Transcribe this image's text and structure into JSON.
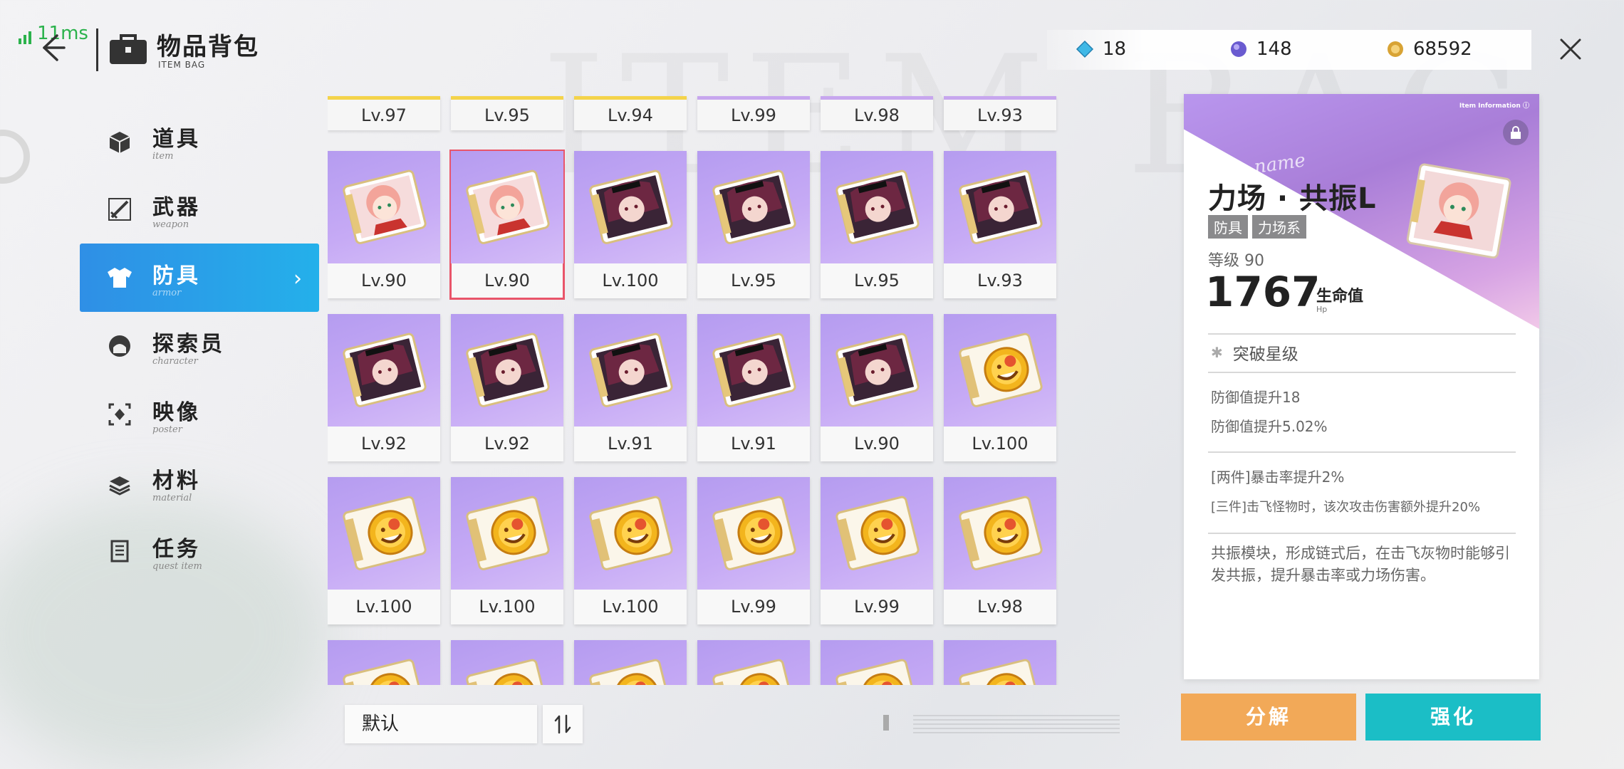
{
  "status": {
    "ping": "11ms"
  },
  "header": {
    "title": "物品背包",
    "subtitle": "ITEM BAG",
    "watermark": "ITEM BAG"
  },
  "currencies": [
    {
      "name": "crystal",
      "value": "18",
      "color": "#3fb8e6"
    },
    {
      "name": "orb",
      "value": "148",
      "color": "#6a5bd0"
    },
    {
      "name": "coin",
      "value": "68592",
      "color": "#d8a334"
    }
  ],
  "menu": [
    {
      "key": "item",
      "label": "道具",
      "sub": "item",
      "icon": "box-icon",
      "active": false
    },
    {
      "key": "weapon",
      "label": "武器",
      "sub": "weapon",
      "icon": "sword-icon",
      "active": false
    },
    {
      "key": "armor",
      "label": "防具",
      "sub": "armor",
      "icon": "shirt-icon",
      "active": true
    },
    {
      "key": "character",
      "label": "探索员",
      "sub": "character",
      "icon": "character-icon",
      "active": false
    },
    {
      "key": "poster",
      "label": "映像",
      "sub": "poster",
      "icon": "poster-icon",
      "active": false
    },
    {
      "key": "material",
      "label": "材料",
      "sub": "material",
      "icon": "material-icon",
      "active": false
    },
    {
      "key": "quest",
      "label": "任务",
      "sub": "quest item",
      "icon": "list-icon",
      "active": false
    }
  ],
  "top_row": [
    {
      "level": "Lv.97",
      "rarity": "gold"
    },
    {
      "level": "Lv.95",
      "rarity": "gold"
    },
    {
      "level": "Lv.94",
      "rarity": "gold"
    },
    {
      "level": "Lv.99",
      "rarity": "purple"
    },
    {
      "level": "Lv.98",
      "rarity": "purple"
    },
    {
      "level": "Lv.93",
      "rarity": "purple"
    }
  ],
  "cards": [
    {
      "level": "Lv.90",
      "art": "pink",
      "selected": false
    },
    {
      "level": "Lv.90",
      "art": "pink",
      "selected": true
    },
    {
      "level": "Lv.100",
      "art": "dark",
      "selected": false
    },
    {
      "level": "Lv.95",
      "art": "dark",
      "selected": false
    },
    {
      "level": "Lv.95",
      "art": "dark",
      "selected": false
    },
    {
      "level": "Lv.93",
      "art": "dark",
      "selected": false
    },
    {
      "level": "Lv.92",
      "art": "dark",
      "selected": false
    },
    {
      "level": "Lv.92",
      "art": "dark",
      "selected": false
    },
    {
      "level": "Lv.91",
      "art": "dark",
      "selected": false
    },
    {
      "level": "Lv.91",
      "art": "dark",
      "selected": false
    },
    {
      "level": "Lv.90",
      "art": "dark",
      "selected": false
    },
    {
      "level": "Lv.100",
      "art": "sun",
      "selected": false
    },
    {
      "level": "Lv.100",
      "art": "sun",
      "selected": false
    },
    {
      "level": "Lv.100",
      "art": "sun",
      "selected": false
    },
    {
      "level": "Lv.100",
      "art": "sun",
      "selected": false
    },
    {
      "level": "Lv.99",
      "art": "sun",
      "selected": false
    },
    {
      "level": "Lv.99",
      "art": "sun",
      "selected": false
    },
    {
      "level": "Lv.98",
      "art": "sun",
      "selected": false
    },
    {
      "level": "",
      "art": "sun",
      "selected": false
    },
    {
      "level": "",
      "art": "sun",
      "selected": false
    },
    {
      "level": "",
      "art": "sun",
      "selected": false
    },
    {
      "level": "",
      "art": "sun",
      "selected": false
    },
    {
      "level": "",
      "art": "sun",
      "selected": false
    },
    {
      "level": "",
      "art": "sun",
      "selected": false
    }
  ],
  "sort": {
    "label": "默认"
  },
  "detail": {
    "info_label": "Item Information",
    "name_script": "Item name",
    "name": "力场 · 共振L",
    "tags": [
      "防具",
      "力场系"
    ],
    "level_line": "等级 90",
    "stat_value": "1767",
    "stat_label": "生命值",
    "stat_sub": "Hp",
    "breakthrough": "突破星级",
    "bonus_1": "防御值提升18",
    "bonus_2": "防御值提升5.02%",
    "set_2": "[两件]暴击率提升2%",
    "set_3": "[三件]击飞怪物时，该次攻击伤害额外提升20%",
    "description": "共振模块，形成链式后，在击飞灰物时能够引发共振，提升暴击率或力场伤害。"
  },
  "actions": {
    "decompose": "分解",
    "enhance": "强化"
  }
}
